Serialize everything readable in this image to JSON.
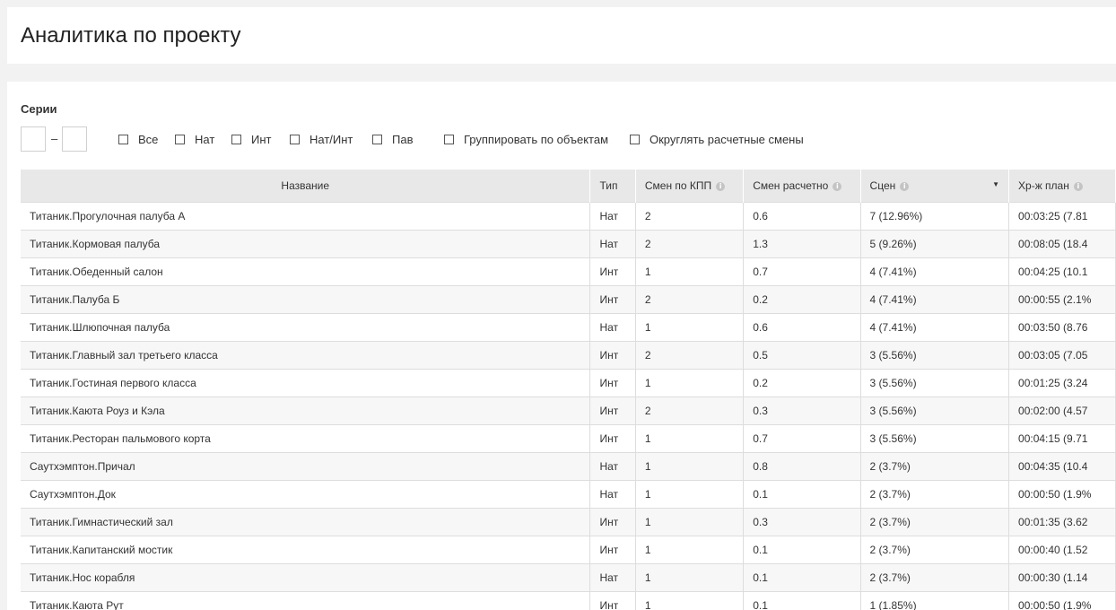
{
  "header": {
    "title": "Аналитика по проекту"
  },
  "filters": {
    "series_label": "Серии",
    "range_from": "",
    "range_to": "",
    "range_dash": "–",
    "checkboxes": [
      {
        "label": "Все",
        "checked": false
      },
      {
        "label": "Нат",
        "checked": false
      },
      {
        "label": "Инт",
        "checked": false
      },
      {
        "label": "Нат/Инт",
        "checked": false
      },
      {
        "label": "Пав",
        "checked": false
      },
      {
        "label": "Группировать по объектам",
        "checked": false
      },
      {
        "label": "Округлять расчетные смены",
        "checked": false
      }
    ]
  },
  "table": {
    "columns": [
      "Название",
      "Тип",
      "Смен по КПП",
      "Смен расчетно",
      "Сцен",
      "Хр-ж план"
    ],
    "sorted_column": "Сцен",
    "rows": [
      [
        "Титаник.Прогулочная палуба А",
        "Нат",
        "2",
        "0.6",
        "7 (12.96%)",
        "00:03:25 (7.81"
      ],
      [
        "Титаник.Кормовая палуба",
        "Нат",
        "2",
        "1.3",
        "5 (9.26%)",
        "00:08:05 (18.4"
      ],
      [
        "Титаник.Обеденный салон",
        "Инт",
        "1",
        "0.7",
        "4 (7.41%)",
        "00:04:25 (10.1"
      ],
      [
        "Титаник.Палуба Б",
        "Инт",
        "2",
        "0.2",
        "4 (7.41%)",
        "00:00:55 (2.1%"
      ],
      [
        "Титаник.Шлюпочная палуба",
        "Нат",
        "1",
        "0.6",
        "4 (7.41%)",
        "00:03:50 (8.76"
      ],
      [
        "Титаник.Главный зал третьего класса",
        "Инт",
        "2",
        "0.5",
        "3 (5.56%)",
        "00:03:05 (7.05"
      ],
      [
        "Титаник.Гостиная первого класса",
        "Инт",
        "1",
        "0.2",
        "3 (5.56%)",
        "00:01:25 (3.24"
      ],
      [
        "Титаник.Каюта Роуз и Кэла",
        "Инт",
        "2",
        "0.3",
        "3 (5.56%)",
        "00:02:00 (4.57"
      ],
      [
        "Титаник.Ресторан пальмового корта",
        "Инт",
        "1",
        "0.7",
        "3 (5.56%)",
        "00:04:15 (9.71"
      ],
      [
        "Саутхэмптон.Причал",
        "Нат",
        "1",
        "0.8",
        "2 (3.7%)",
        "00:04:35 (10.4"
      ],
      [
        "Саутхэмптон.Док",
        "Нат",
        "1",
        "0.1",
        "2 (3.7%)",
        "00:00:50 (1.9%"
      ],
      [
        "Титаник.Гимнастический зал",
        "Инт",
        "1",
        "0.3",
        "2 (3.7%)",
        "00:01:35 (3.62"
      ],
      [
        "Титаник.Капитанский мостик",
        "Инт",
        "1",
        "0.1",
        "2 (3.7%)",
        "00:00:40 (1.52"
      ],
      [
        "Титаник.Нос корабля",
        "Нат",
        "1",
        "0.1",
        "2 (3.7%)",
        "00:00:30 (1.14"
      ],
      [
        "Титаник.Каюта Рут",
        "Инт",
        "1",
        "0.1",
        "1 (1.85%)",
        "00:00:50 (1.9%"
      ]
    ]
  }
}
